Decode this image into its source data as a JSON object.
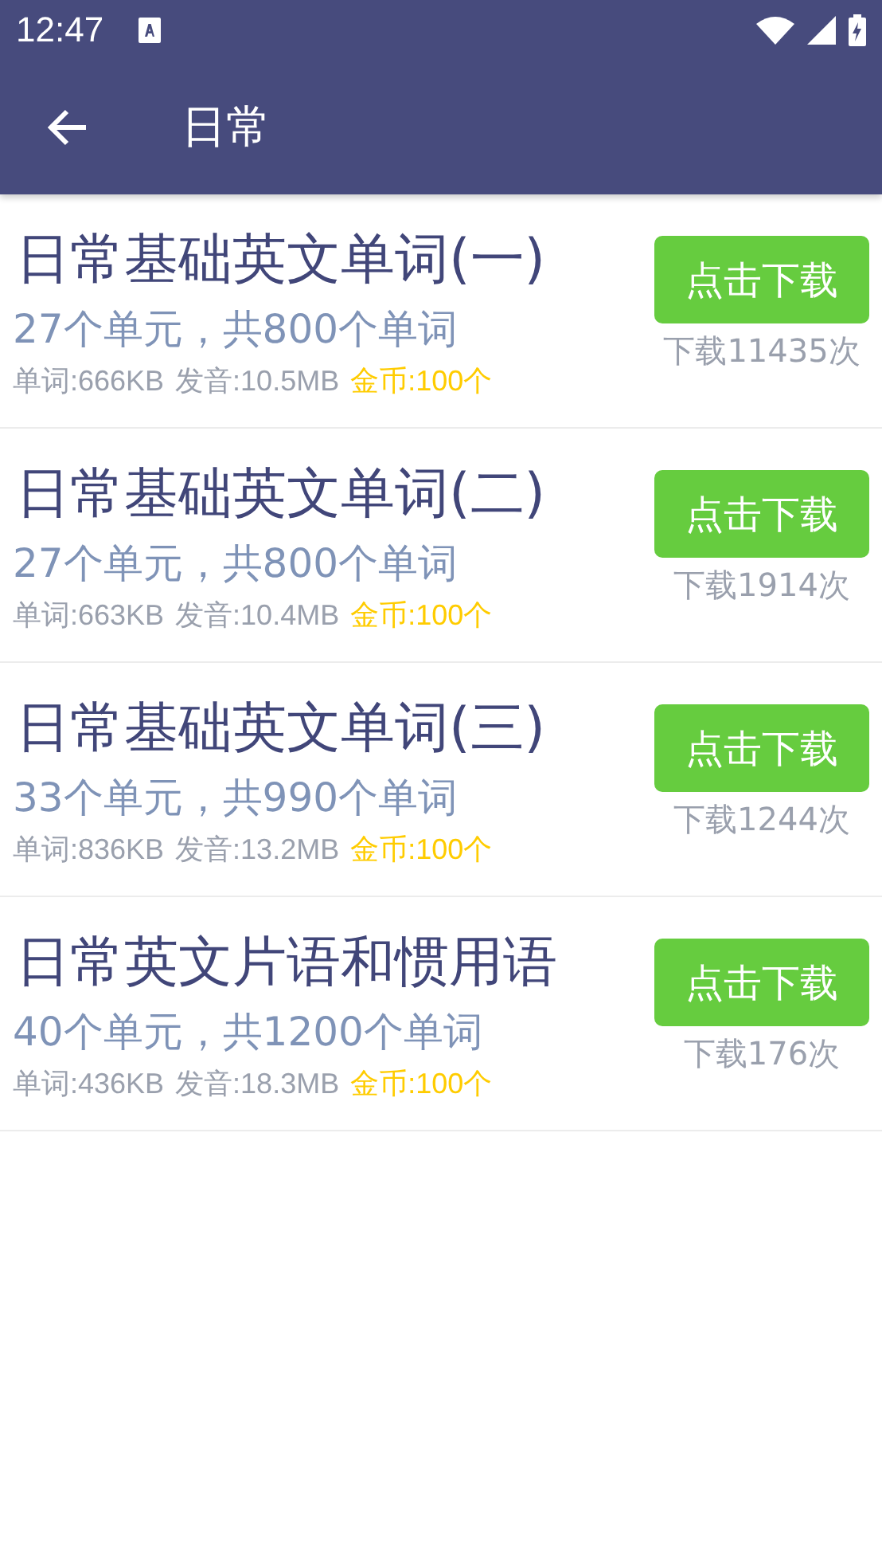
{
  "status_bar": {
    "time": "12:47"
  },
  "app_bar": {
    "title": "日常"
  },
  "items": [
    {
      "title": "日常基础英文单词(一)",
      "summary": "27个单元，共800个单词",
      "words_size": "单词:666KB",
      "audio_size": "发音:10.5MB",
      "coins": "金币:100个",
      "button": "点击下载",
      "downloads": "下载11435次"
    },
    {
      "title": "日常基础英文单词(二)",
      "summary": "27个单元，共800个单词",
      "words_size": "单词:663KB",
      "audio_size": "发音:10.4MB",
      "coins": "金币:100个",
      "button": "点击下载",
      "downloads": "下载1914次"
    },
    {
      "title": "日常基础英文单词(三)",
      "summary": "33个单元，共990个单词",
      "words_size": "单词:836KB",
      "audio_size": "发音:13.2MB",
      "coins": "金币:100个",
      "button": "点击下载",
      "downloads": "下载1244次"
    },
    {
      "title": "日常英文片语和惯用语",
      "summary": "40个单元，共1200个单词",
      "words_size": "单词:436KB",
      "audio_size": "发音:18.3MB",
      "coins": "金币:100个",
      "button": "点击下载",
      "downloads": "下载176次"
    }
  ]
}
